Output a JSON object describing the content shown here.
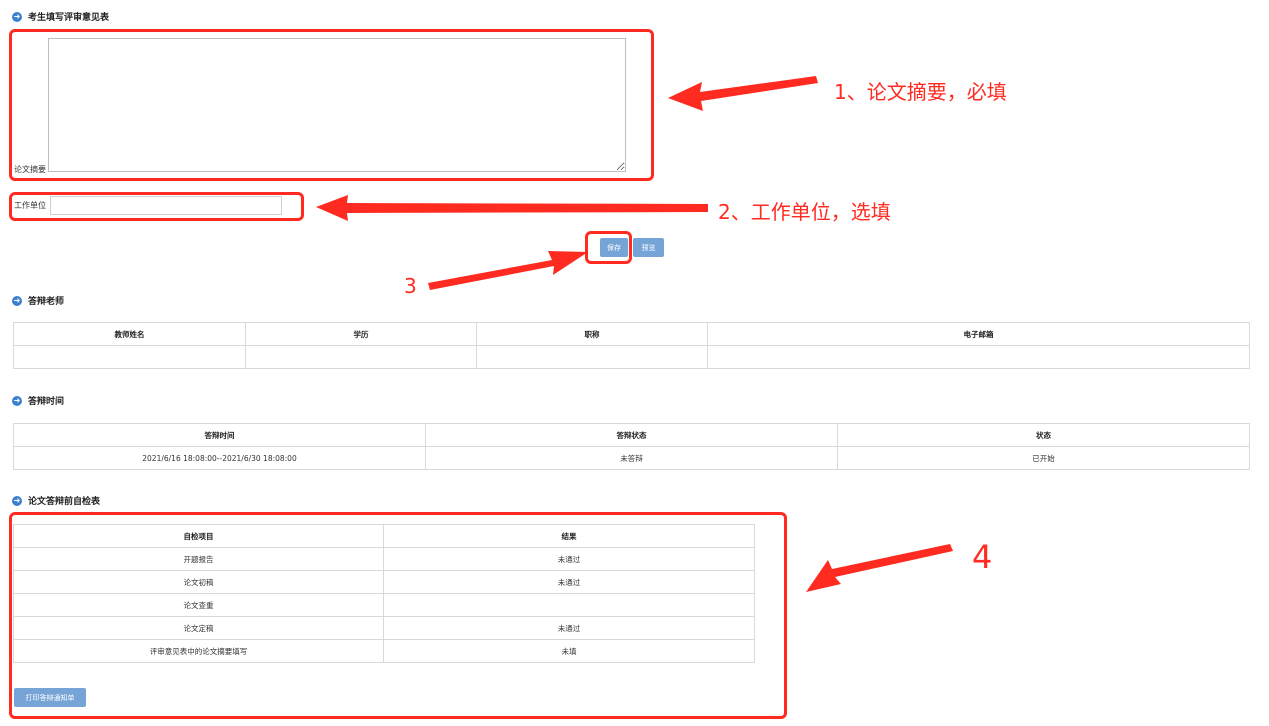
{
  "review_form": {
    "title": "考生填写评审意见表",
    "abstract_label": "论文摘要",
    "abstract_value": "",
    "employer_label": "工作单位",
    "employer_value": "",
    "save_label": "保存",
    "preview_label": "预览"
  },
  "teacher_section": {
    "title": "答辩老师",
    "columns": [
      "教师姓名",
      "学历",
      "职称",
      "电子邮箱"
    ]
  },
  "time_section": {
    "title": "答辩时间",
    "columns": [
      "答辩时间",
      "答辩状态",
      "状态"
    ],
    "row": [
      "2021/6/16 18:08:00--2021/6/30 18:08:00",
      "未答辩",
      "已开始"
    ]
  },
  "selfcheck_section": {
    "title": "论文答辩前自检表",
    "columns": [
      "自检项目",
      "结果"
    ],
    "rows": [
      [
        "开题报告",
        "未通过"
      ],
      [
        "论文初稿",
        "未通过"
      ],
      [
        "论文查重",
        ""
      ],
      [
        "论文定稿",
        "未通过"
      ],
      [
        "评审意见表中的论文摘要填写",
        "未填"
      ]
    ],
    "print_label": "打印答辩通知单"
  },
  "annotations": {
    "note1": "1、论文摘要，必填",
    "note2": "2、工作单位，选填",
    "note3": "3",
    "note4": "4",
    "color": "#ff2a20"
  },
  "colors": {
    "button": "#76a4d6",
    "section_icon": "#3a7fd0"
  }
}
